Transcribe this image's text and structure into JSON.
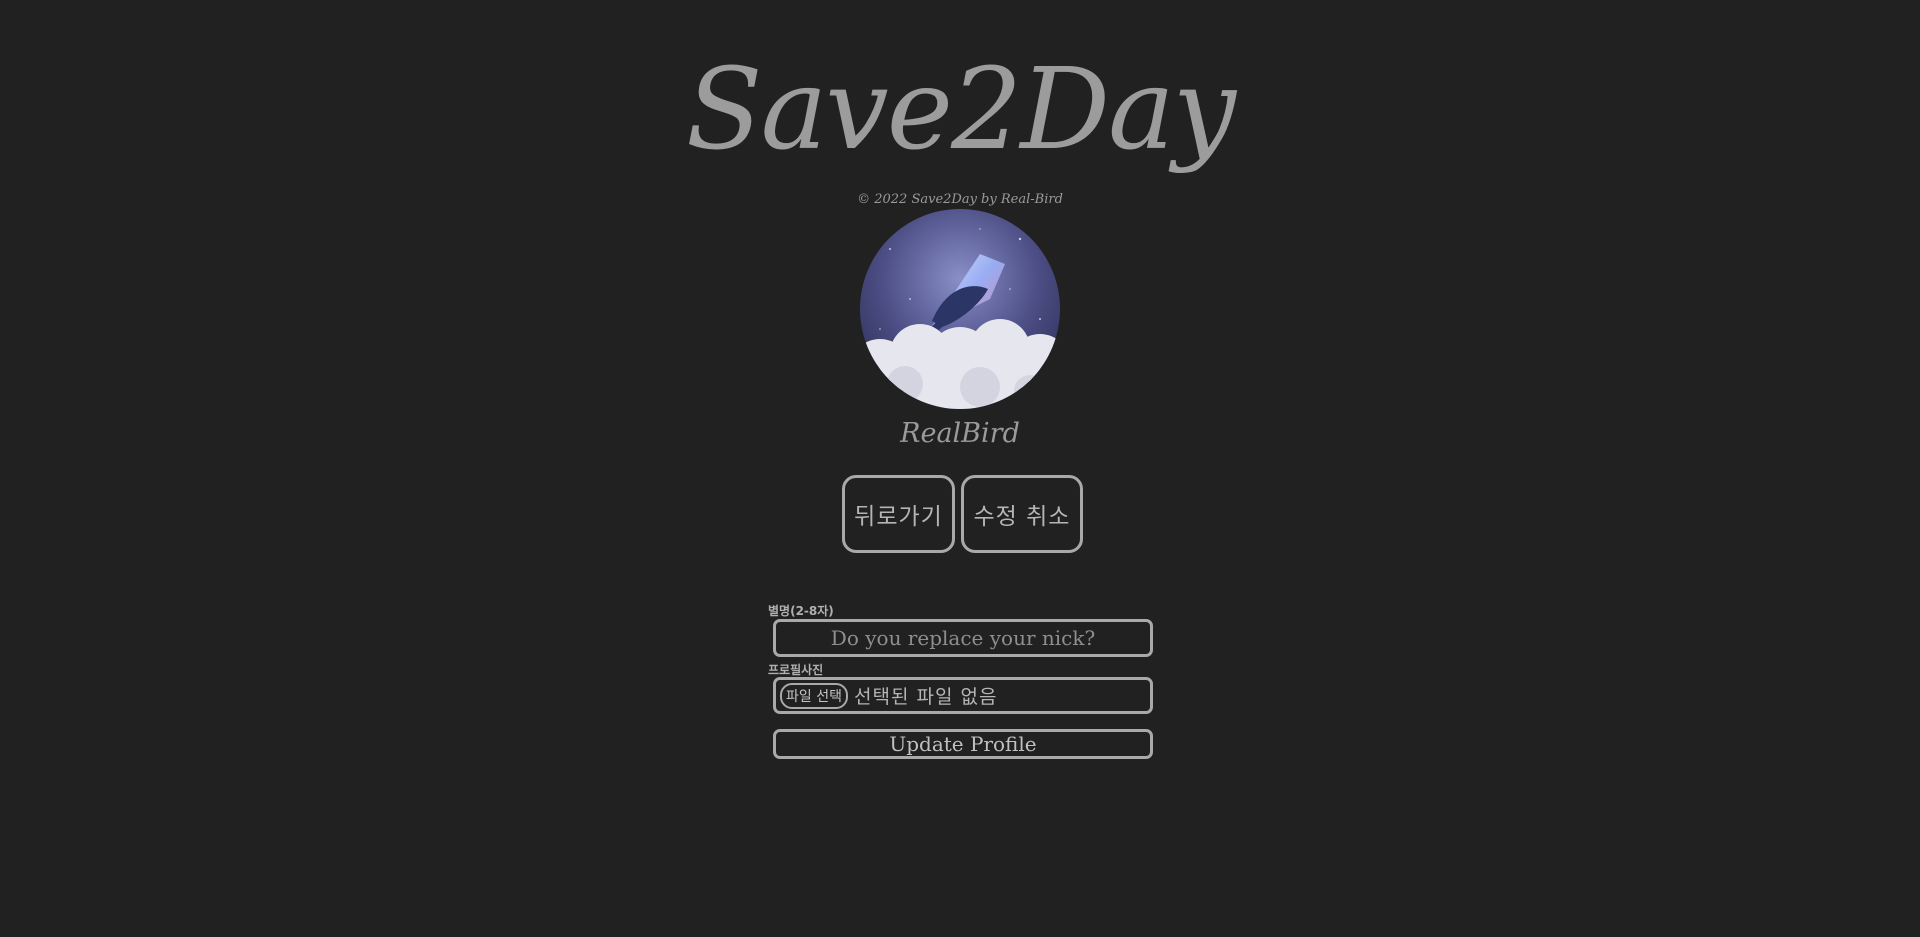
{
  "brand": {
    "logo_text": "Save2Day",
    "copyright": "© 2022 Save2Day by Real-Bird"
  },
  "profile": {
    "nickname": "RealBird"
  },
  "nav": {
    "back_label": "뒤로가기",
    "cancel_label": "수정 취소"
  },
  "form": {
    "nick_label": "별명(2-8자)",
    "nick_placeholder": "Do you replace your nick?",
    "nick_value": "",
    "photo_label": "프로필사진",
    "file_button_label": "파일 선택",
    "file_status": "선택된 파일 없음",
    "submit_label": "Update Profile"
  },
  "colors": {
    "background": "#212121",
    "text": "#a9a9a9",
    "border": "#a9a9a9"
  }
}
